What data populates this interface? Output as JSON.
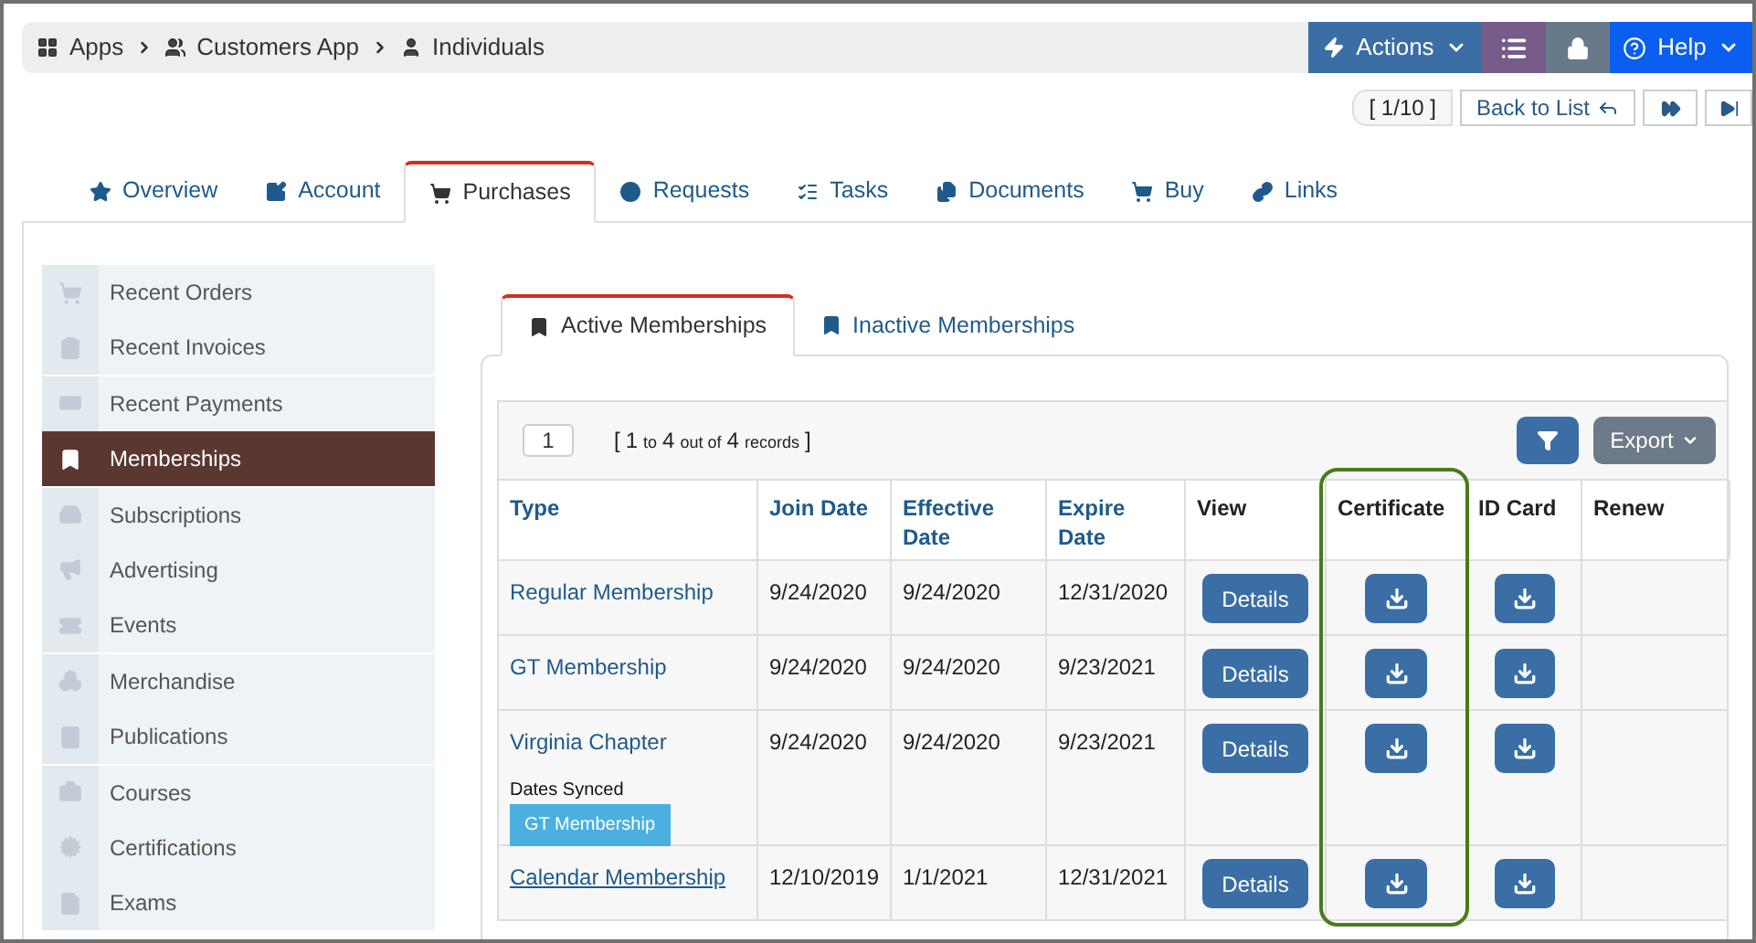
{
  "breadcrumb": [
    "Apps",
    "Customers App",
    "Individuals"
  ],
  "top_actions": [
    {
      "kind": "actions",
      "label": "Actions"
    },
    {
      "kind": "list"
    },
    {
      "kind": "lock"
    },
    {
      "kind": "help",
      "label": "Help"
    }
  ],
  "pager": {
    "position": "[ 1/10 ]",
    "back": "Back to List"
  },
  "tabs": [
    {
      "label": "Overview",
      "selected": false
    },
    {
      "label": "Account",
      "selected": false
    },
    {
      "label": "Purchases",
      "selected": true
    },
    {
      "label": "Requests",
      "selected": false
    },
    {
      "label": "Tasks",
      "selected": false
    },
    {
      "label": "Documents",
      "selected": false
    },
    {
      "label": "Buy",
      "selected": false
    },
    {
      "label": "Links",
      "selected": false
    }
  ],
  "sidebar": {
    "items": [
      {
        "label": "Recent Orders",
        "selected": false
      },
      {
        "label": "Recent Invoices",
        "selected": false
      },
      {
        "label": "Recent Payments",
        "selected": false
      },
      {
        "label": "Memberships",
        "selected": true
      },
      {
        "label": "Subscriptions",
        "selected": false
      },
      {
        "label": "Advertising",
        "selected": false
      },
      {
        "label": "Events",
        "selected": false
      },
      {
        "label": "Merchandise",
        "selected": false
      },
      {
        "label": "Publications",
        "selected": false
      },
      {
        "label": "Courses",
        "selected": false
      },
      {
        "label": "Certifications",
        "selected": false
      },
      {
        "label": "Exams",
        "selected": false
      }
    ]
  },
  "subtabs": [
    {
      "label": "Active Memberships",
      "selected": true
    },
    {
      "label": "Inactive Memberships",
      "selected": false
    }
  ],
  "table": {
    "page": "1",
    "record_info": [
      {
        "text": "[",
        "kind": "big"
      },
      {
        "text": "1",
        "kind": "big"
      },
      {
        "text": "to",
        "kind": "small"
      },
      {
        "text": "4",
        "kind": "big"
      },
      {
        "text": "out of",
        "kind": "small"
      },
      {
        "text": "4",
        "kind": "big"
      },
      {
        "text": "records",
        "kind": "small"
      },
      {
        "text": "]",
        "kind": "big"
      }
    ],
    "export": "Export",
    "columns": [
      {
        "label": "Type",
        "link": true
      },
      {
        "label": "Join Date",
        "link": true
      },
      {
        "label": "Effective Date",
        "link": true
      },
      {
        "label": "Expire Date",
        "link": true
      },
      {
        "label": "View",
        "link": false
      },
      {
        "label": "Certificate",
        "link": false,
        "highlighted": true
      },
      {
        "label": "ID Card",
        "link": false
      },
      {
        "label": "Renew",
        "link": false
      }
    ],
    "rows": [
      {
        "type": "Regular Membership",
        "underlined": false,
        "join": "9/24/2020",
        "effective": "9/24/2020",
        "expire": "12/31/2020",
        "view": "Details"
      },
      {
        "type": "GT Membership",
        "underlined": false,
        "join": "9/24/2020",
        "effective": "9/24/2020",
        "expire": "9/23/2021",
        "view": "Details"
      },
      {
        "type": "Virginia Chapter",
        "underlined": false,
        "sync_note": "Dates Synced",
        "tag": "GT Membership",
        "join": "9/24/2020",
        "effective": "9/24/2020",
        "expire": "9/23/2021",
        "view": "Details"
      },
      {
        "type": "Calendar Membership",
        "underlined": true,
        "join": "12/10/2019",
        "effective": "1/1/2021",
        "expire": "12/31/2021",
        "view": "Details"
      }
    ]
  }
}
